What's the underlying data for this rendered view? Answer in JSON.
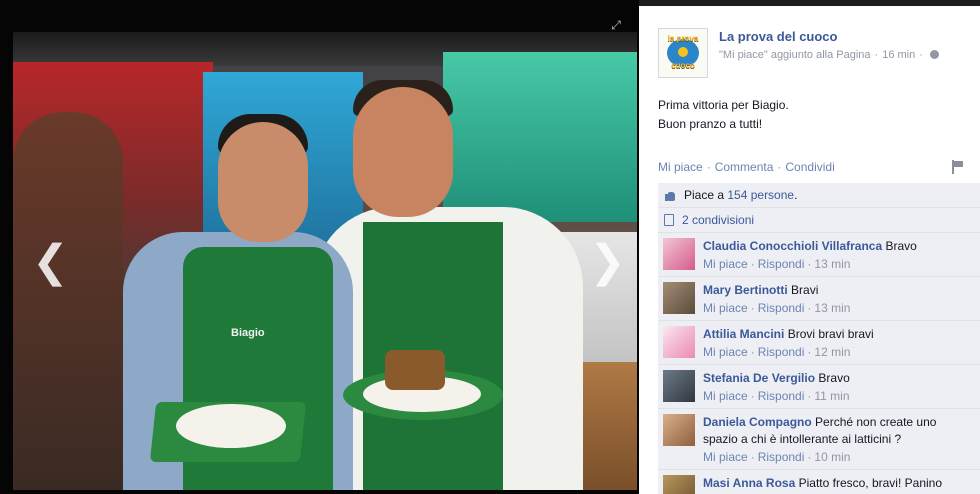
{
  "viewer": {
    "prev_glyph": "❮",
    "next_glyph": "❯",
    "expand_glyph": "⤢",
    "photo_caption_apron": "Biagio"
  },
  "post": {
    "page_name": "La prova del cuoco",
    "logo_text_top": "la prova",
    "logo_text_bottom": "cuoco",
    "meta_text": "\"Mi piace\" aggiunto alla Pagina",
    "meta_time": "16 min",
    "status_line1": "Prima vittoria per Biagio.",
    "status_line2": "Buon pranzo a tutti!",
    "action_like": "Mi piace",
    "action_comment": "Commenta",
    "action_share": "Condividi",
    "likes_prefix": "Piace a ",
    "likes_link": "154 persone",
    "likes_suffix": ".",
    "shares_link": "2 condivisioni"
  },
  "comment_actions": {
    "like": "Mi piace",
    "reply": "Rispondi"
  },
  "comments": [
    {
      "author": "Claudia Conocchioli Villafranca",
      "text": "Bravo",
      "time": "13 min"
    },
    {
      "author": "Mary Bertinotti",
      "text": "Bravi",
      "time": "13 min"
    },
    {
      "author": "Attilia Mancini",
      "text": "Brovi bravi bravi",
      "time": "12 min"
    },
    {
      "author": "Stefania De Vergilio",
      "text": "Bravo",
      "time": "11 min"
    },
    {
      "author": "Daniela Compagno",
      "text": "Perché non create uno spazio a chi è intollerante ai latticini ?",
      "time": "10 min"
    },
    {
      "author": "Masi Anna Rosa",
      "text": "Piatto fresco, bravi! Panino",
      "time": ""
    }
  ]
}
